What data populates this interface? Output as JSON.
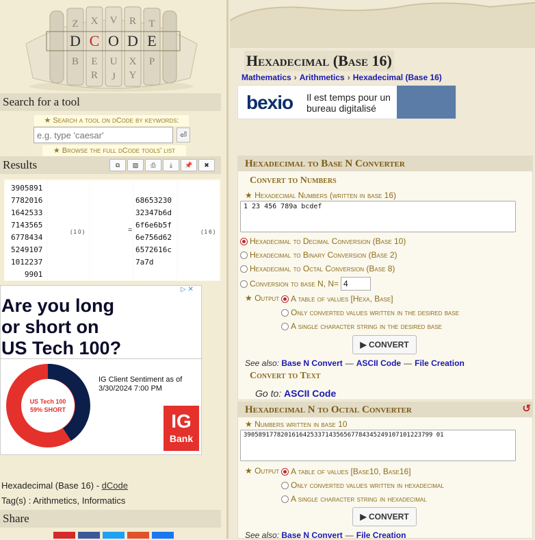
{
  "left": {
    "search_title": "Search for a tool",
    "search_link": "★ Search a tool on dCode by keywords:",
    "search_placeholder": "e.g. type 'caesar'",
    "search_submit": "⏎",
    "browse_link": "★ Browse the full dCode tools' list",
    "results_title": "Results",
    "result_tools": [
      "⧉",
      "▨",
      "⎙",
      "⤓",
      "📌",
      "✖"
    ],
    "result_left_numbers": "3905891\n7782016\n1642533\n7143565\n6778434\n5249107\n1012237\n   9901",
    "result_left_base": "(10)",
    "result_equals": "=",
    "result_right_numbers": "\n68653230\n32347b6d\n6f6e6b5f\n6e756d62\n6572616c\n7a7d",
    "result_right_base": "(16)",
    "ad": {
      "headline": "Are you long\nor short on\nUS Tech 100?",
      "sentiment": "IG Client Sentiment as of 3/30/2024 7:00 PM",
      "donut_label": "US Tech 100",
      "donut_value": "59% SHORT",
      "brand": "IG",
      "brand_sub": "Bank"
    },
    "caption_text": "Hexadecimal (Base 16) - ",
    "caption_link": "dCode",
    "tags": "Tag(s) : Arithmetics, Informatics",
    "share_title": "Share",
    "share_colors": [
      "#d42a2a",
      "#3b5998",
      "#1da1f2",
      "#e0522b",
      "#1877f2"
    ]
  },
  "right": {
    "title": "Hexadecimal (Base 16)",
    "breadcrumbs": [
      "Mathematics",
      "Arithmetics",
      "Hexadecimal (Base 16)"
    ],
    "ad_top": {
      "logo": "bexio",
      "text": "Il est temps pour un bureau digitalisé"
    },
    "tool1": {
      "title": "Hexadecimal to Base N Converter",
      "sub1": "Convert to Numbers",
      "field_label": "★ Hexadecimal Numbers (written in base 16)",
      "field_value": "1 23 456 789a bcdef",
      "options": [
        "Hexadecimal to Decimal Conversion (Base 10)",
        "Hexadecimal to Binary Conversion (Base 2)",
        "Hexadecimal to Octal Conversion (Base 8)",
        "Conversion to base N, N="
      ],
      "base_n_value": "4",
      "output_label": "★ Output",
      "outputs": [
        "A table of values [Hexa, Base]",
        "Only converted values written in the desired base",
        "A single character string in the desired base"
      ],
      "convert": "▶ CONVERT",
      "see_also_label": "See also:",
      "see_also": [
        "Base N Convert",
        "ASCII Code",
        "File Creation"
      ],
      "sub2": "Convert to Text",
      "goto_label": "Go to:",
      "goto_link": "ASCII Code"
    },
    "tool2": {
      "title": "Hexadecimal N to Octal Converter",
      "reset_icon": "↺",
      "field_label": "★ Numbers written in base 10",
      "field_value": "390589177820161642533714356567784345249107101223799 01",
      "output_label": "★ Output",
      "outputs": [
        "A table of values [Base10, Base16]",
        "Only converted values written in hexadecimal",
        "A single character string in hexadecimal"
      ],
      "convert": "▶ CONVERT",
      "see_also_label": "See also:",
      "see_also": [
        "Base N Convert",
        "File Creation"
      ]
    }
  }
}
